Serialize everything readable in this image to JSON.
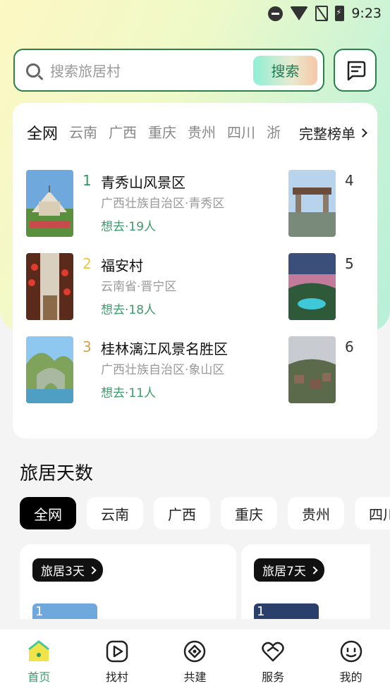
{
  "status_bar": {
    "time": "9:23"
  },
  "search": {
    "placeholder": "搜索旅居村",
    "button": "搜索"
  },
  "ranking": {
    "tabs": [
      "全网",
      "云南",
      "广西",
      "重庆",
      "贵州",
      "四川",
      "浙"
    ],
    "full_list": "完整榜单",
    "items": [
      {
        "rank": "1",
        "name": "青秀山风景区",
        "location": "广西壮族自治区·青秀区",
        "want": "想去·19人"
      },
      {
        "rank": "2",
        "name": "福安村",
        "location": "云南省·晋宁区",
        "want": "想去·18人"
      },
      {
        "rank": "3",
        "name": "桂林漓江风景名胜区",
        "location": "广西壮族自治区·象山区",
        "want": "想去·11人"
      },
      {
        "rank": "4",
        "name": ""
      },
      {
        "rank": "5",
        "name": ""
      },
      {
        "rank": "6",
        "name": ""
      }
    ],
    "rank_colors": [
      "#2e9a5e",
      "#e8c93a",
      "#d4a24a",
      "#333333",
      "#333333",
      "#333333"
    ]
  },
  "days_section": {
    "title": "旅居天数",
    "tabs": [
      "全网",
      "云南",
      "广西",
      "重庆",
      "贵州",
      "四川"
    ],
    "cards": [
      {
        "badge": "旅居3天",
        "first_rank": "1"
      },
      {
        "badge": "旅居7天",
        "first_rank": "1"
      }
    ]
  },
  "bottom_nav": [
    {
      "label": "首页",
      "icon": "home-icon",
      "active": true
    },
    {
      "label": "找村",
      "icon": "video-play-icon",
      "active": false
    },
    {
      "label": "共建",
      "icon": "build-circle-icon",
      "active": false
    },
    {
      "label": "服务",
      "icon": "heart-hands-icon",
      "active": false
    },
    {
      "label": "我的",
      "icon": "face-smile-icon",
      "active": false
    }
  ],
  "colors": {
    "accent": "#3d9a6b",
    "border": "#2e7d4f"
  }
}
